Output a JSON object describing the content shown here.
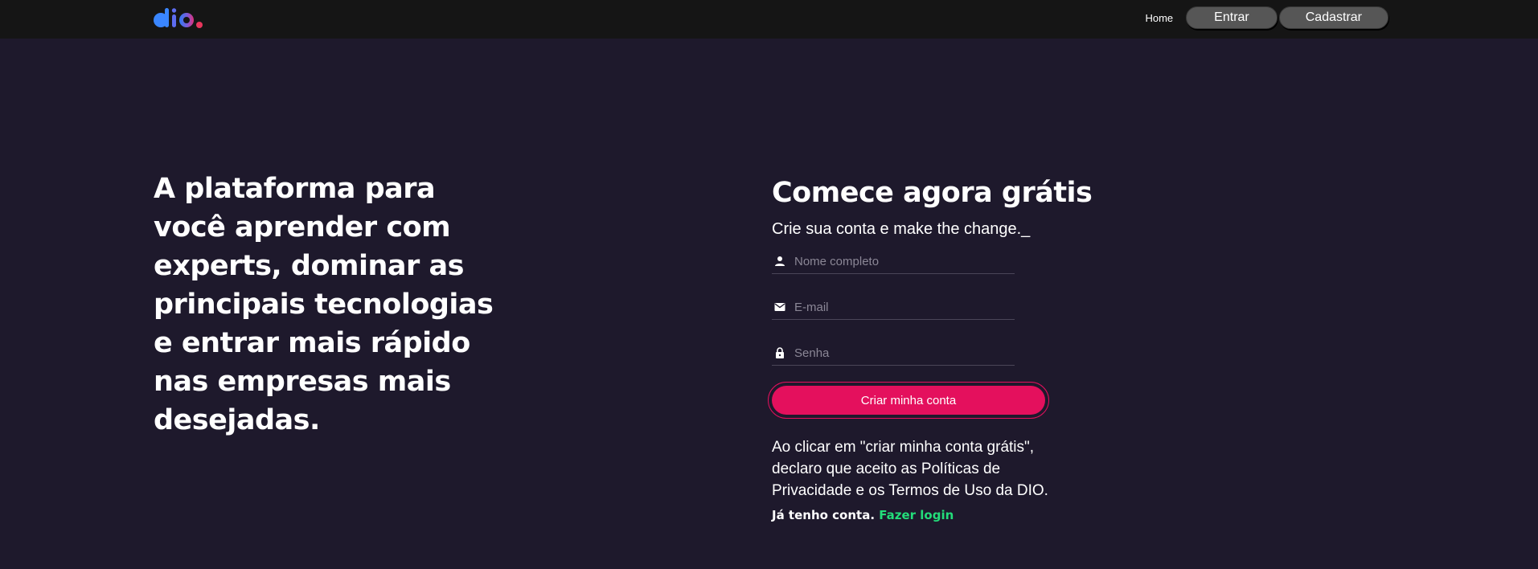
{
  "header": {
    "logo_text": "dio.",
    "nav": {
      "home_label": "Home",
      "login_label": "Entrar",
      "signup_label": "Cadastrar"
    }
  },
  "hero": {
    "headline": "A plataforma para você aprender com experts, dominar as principais tecnologias e entrar mais rápido nas empresas mais desejadas."
  },
  "signup_form": {
    "title": "Comece agora grátis",
    "subtitle": "Crie sua conta e make the change._",
    "fields": {
      "name": {
        "placeholder": "Nome completo",
        "icon": "user-icon"
      },
      "email": {
        "placeholder": "E-mail",
        "icon": "mail-icon"
      },
      "password": {
        "placeholder": "Senha",
        "icon": "lock-icon"
      }
    },
    "submit_label": "Criar minha conta",
    "legal_text": "Ao clicar em \"criar minha conta grátis\", declaro que aceito as Políticas de Privacidade e os Termos de Uso da DIO.",
    "already_have_account": "Já tenho conta.",
    "login_link": "Fazer login"
  },
  "colors": {
    "background": "#1e192c",
    "header": "#151515",
    "accent": "#e4105d",
    "link_green": "#23dd7a"
  }
}
